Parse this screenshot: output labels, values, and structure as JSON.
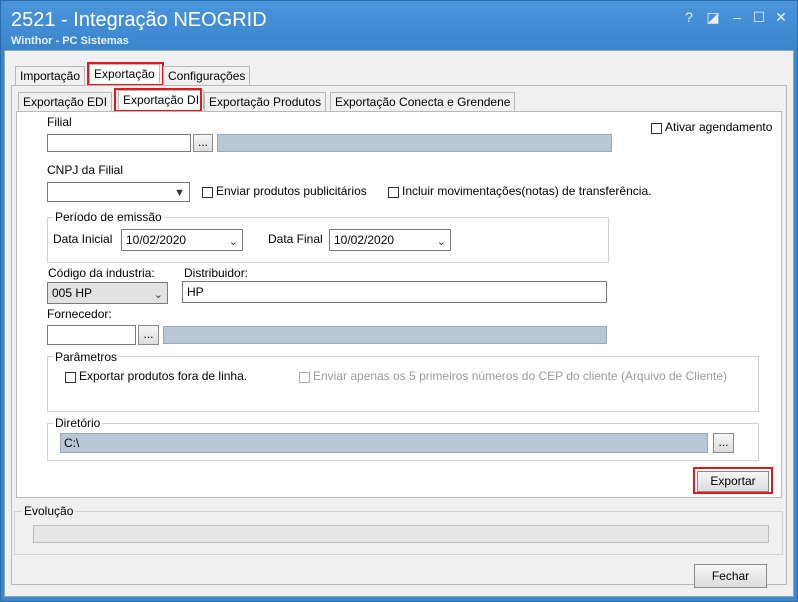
{
  "window": {
    "title": "2521 - Integração NEOGRID",
    "subtitle": "Winthor - PC Sistemas",
    "controls": {
      "help": "?",
      "restore": "◪",
      "minimize": "–",
      "maximize": "☐",
      "close": "✕"
    }
  },
  "tabs_top": [
    "Importação",
    "Exportação",
    "Configurações"
  ],
  "tabs_sub": [
    "Exportação EDI",
    "Exportação DI",
    "Exportação Produtos",
    "Exportação Conecta e Grendene"
  ],
  "filial": {
    "label": "Filial",
    "value": "",
    "browse": "..."
  },
  "agendamento": {
    "label": "Ativar agendamento"
  },
  "cnpj": {
    "label": "CNPJ da Filial",
    "value": ""
  },
  "checks": {
    "publicitarios": "Enviar produtos publicitários",
    "transferencia": "Incluir movimentações(notas) de transferência."
  },
  "periodo": {
    "title": "Período de emissão",
    "inicial_label": "Data Inicial",
    "inicial_value": "10/02/2020",
    "final_label": "Data Final",
    "final_value": "10/02/2020"
  },
  "industria": {
    "label": "Código da industria:",
    "value": "005 HP"
  },
  "distribuidor": {
    "label": "Distribuidor:",
    "value": "HP"
  },
  "fornecedor": {
    "label": "Fornecedor:",
    "value": "",
    "browse": "..."
  },
  "parametros": {
    "title": "Parâmetros",
    "fora_linha": "Exportar produtos fora de linha.",
    "cep": "Enviar apenas os 5 primeiros números do CEP do cliente (Arquivo de Cliente)"
  },
  "diretorio": {
    "title": "Diretório",
    "value": "C:\\",
    "browse": "..."
  },
  "buttons": {
    "exportar": "Exportar",
    "fechar": "Fechar"
  },
  "evolucao": {
    "title": "Evolução",
    "progress": 0
  },
  "colors": {
    "titlebar": "#3c88d0",
    "highlight": "#e01a1a",
    "readonly": "#b8c7d6"
  }
}
